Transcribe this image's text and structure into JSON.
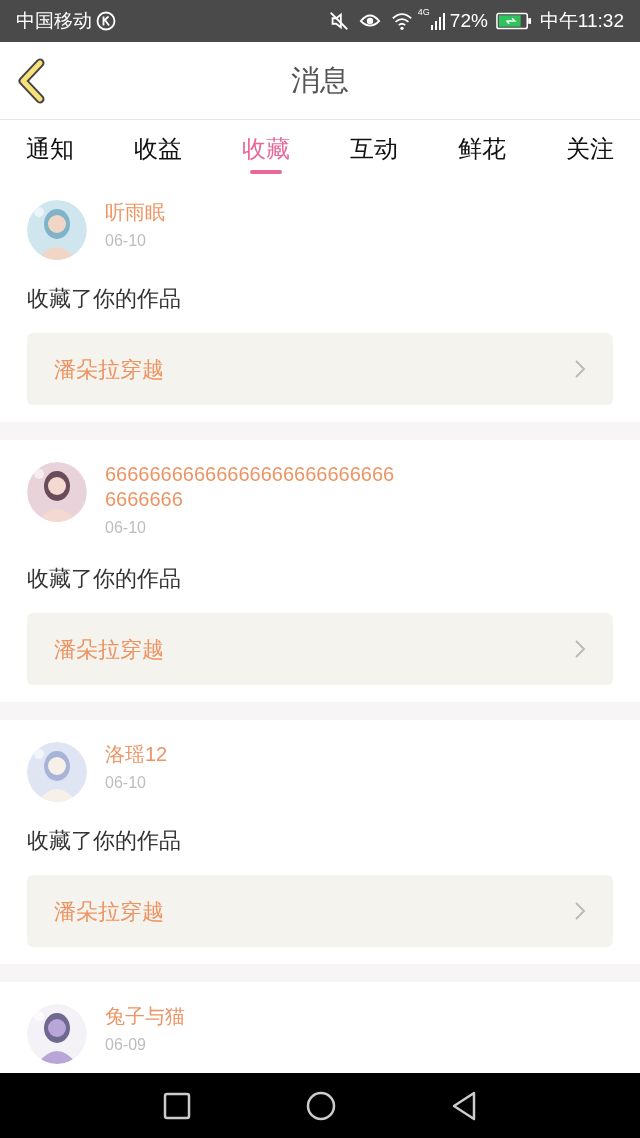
{
  "status_bar": {
    "carrier": "中国移动",
    "network": "4G",
    "battery": "72%",
    "time": "中午11:32"
  },
  "header": {
    "title": "消息"
  },
  "tabs": [
    {
      "label": "通知",
      "selected": false
    },
    {
      "label": "收益",
      "selected": false
    },
    {
      "label": "收藏",
      "selected": true
    },
    {
      "label": "互动",
      "selected": false
    },
    {
      "label": "鲜花",
      "selected": false
    },
    {
      "label": "关注",
      "selected": false
    }
  ],
  "messages": [
    {
      "user": "听雨眠",
      "date": "06-10",
      "text": "收藏了你的作品",
      "work": "潘朵拉穿越"
    },
    {
      "user": "666666666666666666666666666666666",
      "date": "06-10",
      "text": "收藏了你的作品",
      "work": "潘朵拉穿越"
    },
    {
      "user": "洛瑶12",
      "date": "06-10",
      "text": "收藏了你的作品",
      "work": "潘朵拉穿越"
    },
    {
      "user": "兔子与猫",
      "date": "06-09"
    }
  ]
}
